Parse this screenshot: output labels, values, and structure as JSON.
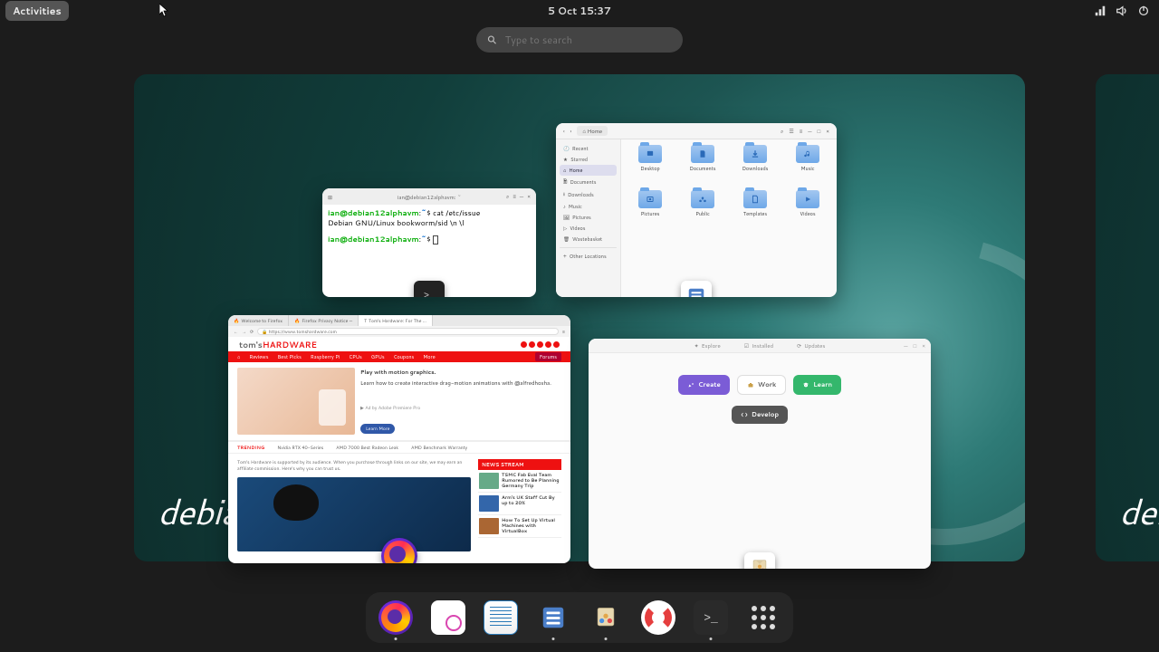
{
  "topbar": {
    "activities": "Activities",
    "clock": "5 Oct  15:37"
  },
  "search": {
    "placeholder": "Type to search"
  },
  "debian_logo": "debian",
  "terminal": {
    "title": "ian@debian12alphavm: ~",
    "user": "ian@debian12alphavm",
    "path": "~",
    "cmd": "cat /etc/issue",
    "out": "Debian GNU/Linux bookworm/sid \\n \\l"
  },
  "files": {
    "loc": "Home",
    "sidebar": {
      "recent": "Recent",
      "starred": "Starred",
      "home": "Home",
      "documents": "Documents",
      "downloads": "Downloads",
      "music": "Music",
      "pictures": "Pictures",
      "videos": "Videos",
      "wastebasket": "Wastebasket",
      "other": "Other Locations"
    },
    "folders": [
      "Desktop",
      "Documents",
      "Downloads",
      "Music",
      "Pictures",
      "Public",
      "Templates",
      "Videos"
    ]
  },
  "browser": {
    "tabs": [
      "Welcome to Firefox",
      "Firefox Privacy Notice —",
      "Tom's Hardware: For The …"
    ],
    "url": "https://www.tomshardware.com",
    "logo1": "tom's",
    "logo2": "HARDWARE",
    "nav": [
      "Reviews",
      "Best Picks",
      "Raspberry Pi",
      "CPUs",
      "GPUs",
      "Coupons",
      "More"
    ],
    "nav_forums": "Forums",
    "hero": {
      "title": "Play with motion graphics.",
      "sub": "Learn how to create interactive drag-motion animations with @alfredhoxha.",
      "ad": "Ad by Adobe Premiere Pro",
      "btn": "Learn More"
    },
    "trending": [
      "TRENDING",
      "Nvidia RTX 40-Series",
      "AMD 7000 Best Radeon Leak",
      "AMD Benchmark Warranty"
    ],
    "content_sub": "Tom's Hardware is supported by its audience. When you purchase through links on our site, we may earn an affiliate commission. Here's why you can trust us.",
    "newsstream": "NEWS STREAM",
    "news": [
      "TSMC Fab Eval Team Rumored to Be Planning Germany Trip",
      "Arm's UK Staff Cut By up to 20%",
      "How To Set Up Virtual Machines with VirtualBox"
    ]
  },
  "software": {
    "tabs": {
      "explore": "Explore",
      "installed": "Installed",
      "updates": "Updates"
    },
    "btns": {
      "create": "Create",
      "work": "Work",
      "learn": "Learn",
      "develop": "Develop"
    }
  },
  "dock": [
    "Firefox",
    "Evolution",
    "LibreOffice Writer",
    "Files",
    "Software",
    "Help",
    "Terminal",
    "Show Applications"
  ]
}
